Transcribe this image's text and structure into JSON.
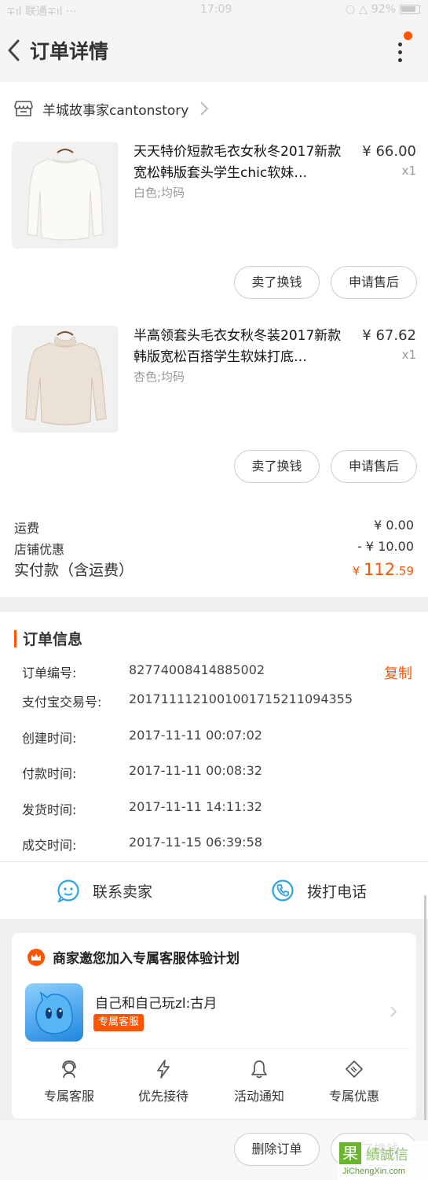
{
  "status_bar": {
    "left": "∓ıl 联通∓ıl ···",
    "time": "17:09",
    "battery": "92%"
  },
  "nav": {
    "title": "订单详情"
  },
  "store": {
    "name": "羊城故事家cantonstory"
  },
  "items": [
    {
      "name": "天天特价短款毛衣女秋冬2017新款宽松韩版套头学生chic软妹…",
      "spec": "白色;均码",
      "price": "¥ 66.00",
      "qty": "x1",
      "btn_sell": "卖了换钱",
      "btn_after": "申请售后"
    },
    {
      "name": "半高领套头毛衣女秋冬装2017新款韩版宽松百搭学生软妹打底…",
      "spec": "杏色;均码",
      "price": "¥ 67.62",
      "qty": "x1",
      "btn_sell": "卖了换钱",
      "btn_after": "申请售后"
    }
  ],
  "fees": {
    "shipping_label": "运费",
    "shipping_value": "¥ 0.00",
    "discount_label": "店铺优惠",
    "discount_value": "- ¥ 10.00",
    "total_label": "实付款（含运费）",
    "total_currency": "¥ ",
    "total_int": "112",
    "total_dec": ".59"
  },
  "order_info": {
    "title": "订单信息",
    "copy_label": "复制",
    "rows": [
      {
        "key": "订单编号:",
        "value": "82774008414885002"
      },
      {
        "key": "支付宝交易号:",
        "value": "2017111121001001715211094355"
      },
      {
        "key": "创建时间:",
        "value": "2017-11-11 00:07:02"
      },
      {
        "key": "付款时间:",
        "value": "2017-11-11 00:08:32"
      },
      {
        "key": "发货时间:",
        "value": "2017-11-11 14:11:32"
      },
      {
        "key": "成交时间:",
        "value": "2017-11-15 06:39:58"
      }
    ],
    "contact_seller": "联系卖家",
    "call_phone": "拨打电话"
  },
  "promo": {
    "title": "商家邀您加入专属客服体验计划",
    "user_name": "自己和自己玩zl:古月",
    "tag": "专属客服",
    "benefits": [
      {
        "label": "专属客服"
      },
      {
        "label": "优先接待"
      },
      {
        "label": "活动通知"
      },
      {
        "label": "专属优惠"
      }
    ]
  },
  "bottom": {
    "delete_order": "删除订单",
    "sell_for_cash": "卖了换钱"
  },
  "watermark": {
    "text": "JiChengXin.com",
    "cn": "績誠信"
  },
  "colors": {
    "accent": "#ff5500",
    "text": "#333333",
    "muted": "#999999",
    "background": "#efefef"
  }
}
